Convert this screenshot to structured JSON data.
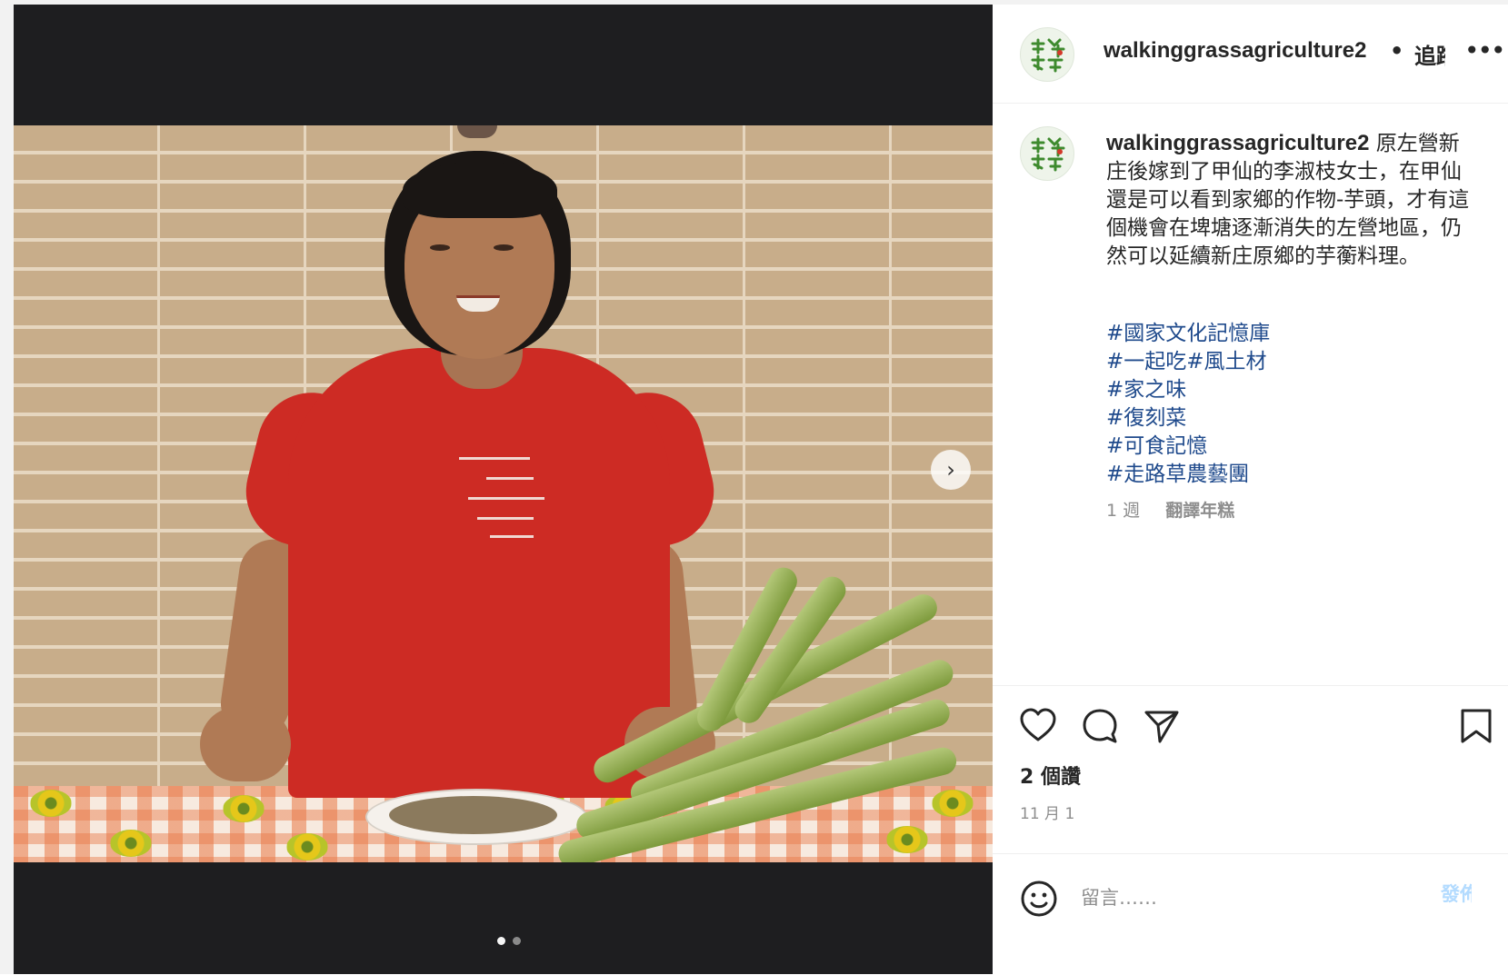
{
  "post": {
    "username": "walkinggrassagriculture2",
    "header_separator": "•",
    "follow_label": "追蹤",
    "more_label": "•••",
    "caption_text": "原左營新庄後嫁到了甲仙的李淑枝女士，在甲仙還是可以看到家鄉的作物-芋頭，才有這個機會在埤塘逐漸消失的左營地區，仍然可以延續新庄原鄉的芋蘅料理。",
    "hashtags": [
      "#國家文化記憶庫",
      "#一起吃#風土材",
      "#家之味",
      "#復刻菜",
      "#可食記憶",
      "#走路草農藝團"
    ],
    "time_ago": "1 週",
    "translate_label": "翻譯年糕",
    "likes": "2 個讚",
    "date": "11 月 1",
    "comment_placeholder": "留言……",
    "post_button": "發佈"
  },
  "media": {
    "carousel_count": 2,
    "carousel_active": 0,
    "next_icon": "chevron-right-icon"
  },
  "icons": {
    "like": "heart-icon",
    "comment": "comment-bubble-icon",
    "share": "paper-plane-icon",
    "save": "bookmark-icon",
    "emoji": "smiley-icon",
    "avatar": "walking-grass-logo"
  },
  "colors": {
    "hashtag": "#1f4a8c",
    "post_button": "#b3dbff",
    "muted_text": "#8e8e8e",
    "media_background": "#1e1e20"
  }
}
